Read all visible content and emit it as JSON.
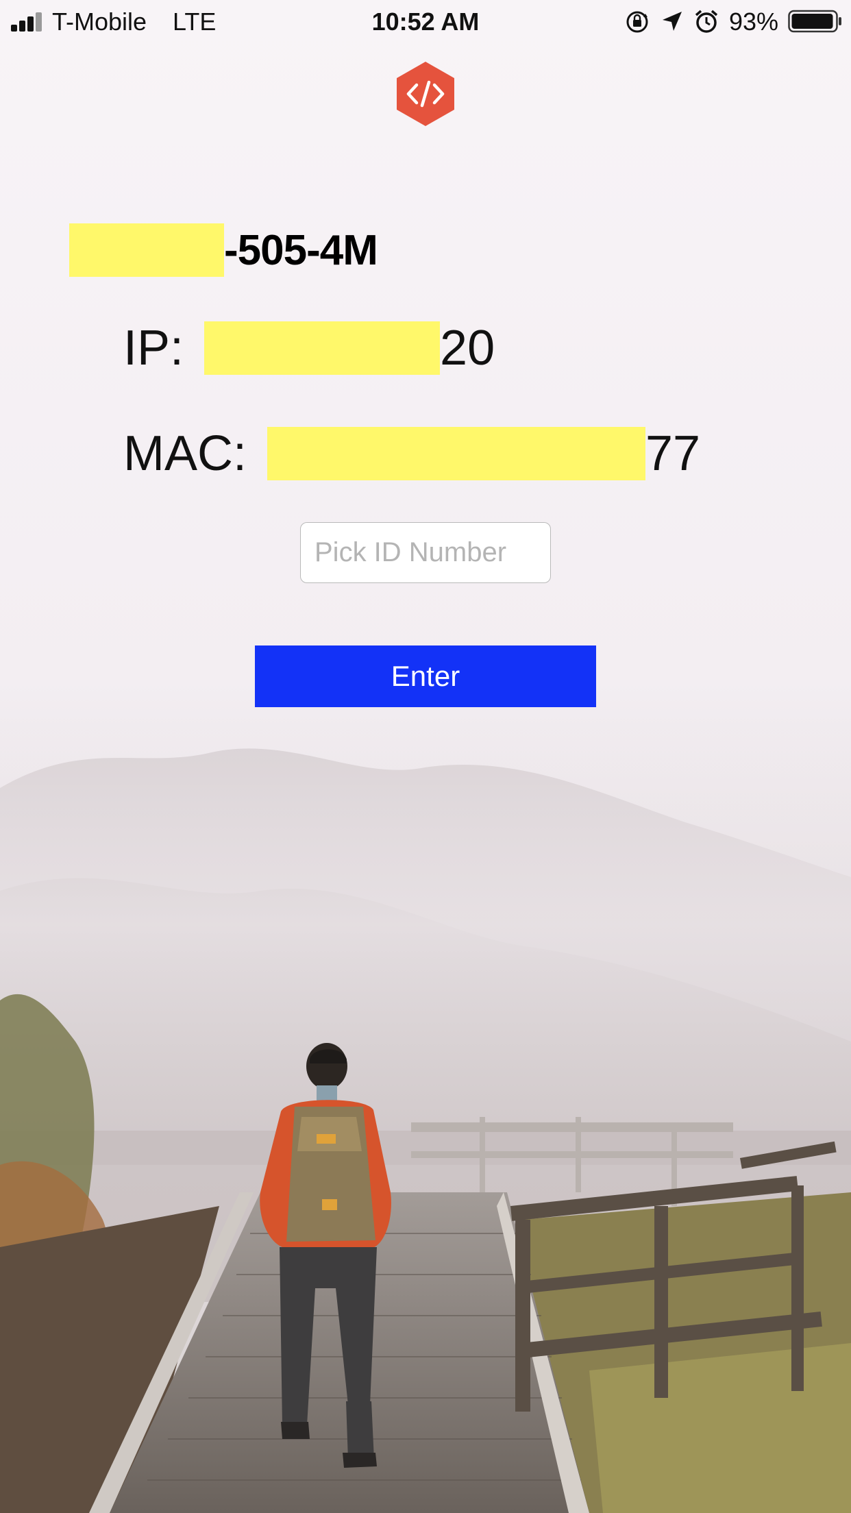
{
  "status_bar": {
    "carrier": "T-Mobile",
    "network": "LTE",
    "time": "10:52 AM",
    "battery_percent": "93%",
    "icons": [
      "signal-icon",
      "orientation-lock-icon",
      "location-arrow-icon",
      "alarm-icon",
      "battery-icon"
    ]
  },
  "logo": {
    "icon": "code-brackets-hexagon-icon",
    "color": "#e5533d"
  },
  "device": {
    "name_suffix": "-505-4M",
    "ip_label": "IP:",
    "ip_suffix": "20",
    "mac_label": "MAC:",
    "mac_suffix": "77",
    "redaction_color": "#fff86a"
  },
  "form": {
    "id_placeholder": "Pick ID Number",
    "id_value": "",
    "enter_label": "Enter",
    "button_color": "#1332f7"
  }
}
